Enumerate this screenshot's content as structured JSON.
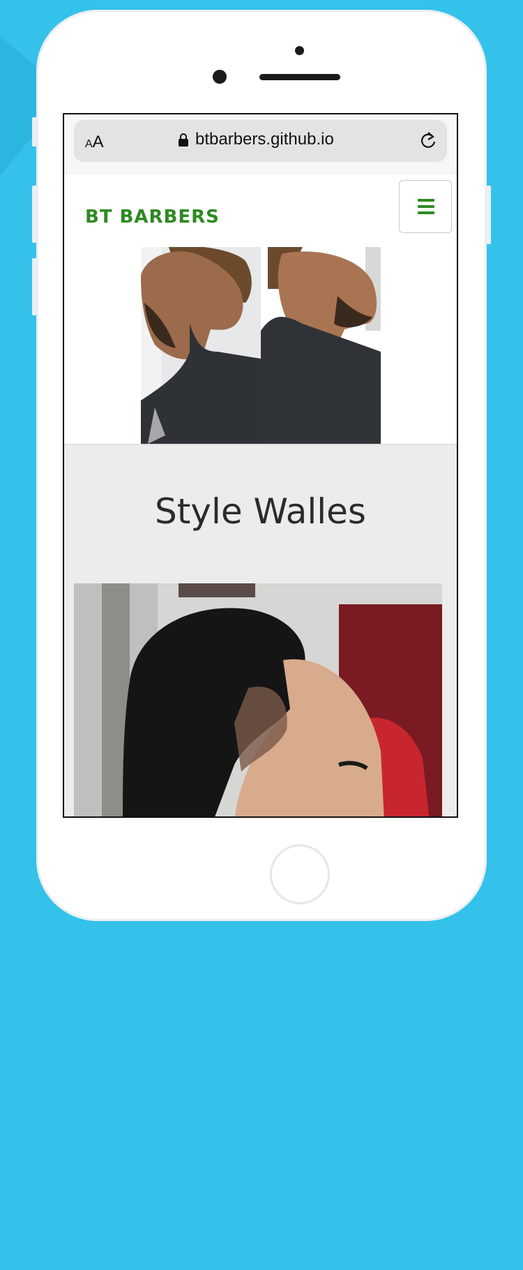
{
  "browser": {
    "aa_small": "A",
    "aa_big": "A",
    "url": "btbarbers.github.io"
  },
  "site": {
    "brand": "BT BARBERS",
    "section_title": "Style Walles"
  },
  "colors": {
    "background": "#34c2ea",
    "brand": "#2d8a22",
    "section_bg": "#ececec"
  },
  "icons": {
    "lock": "lock-icon",
    "reload": "reload-icon",
    "menu": "hamburger-menu-icon"
  }
}
